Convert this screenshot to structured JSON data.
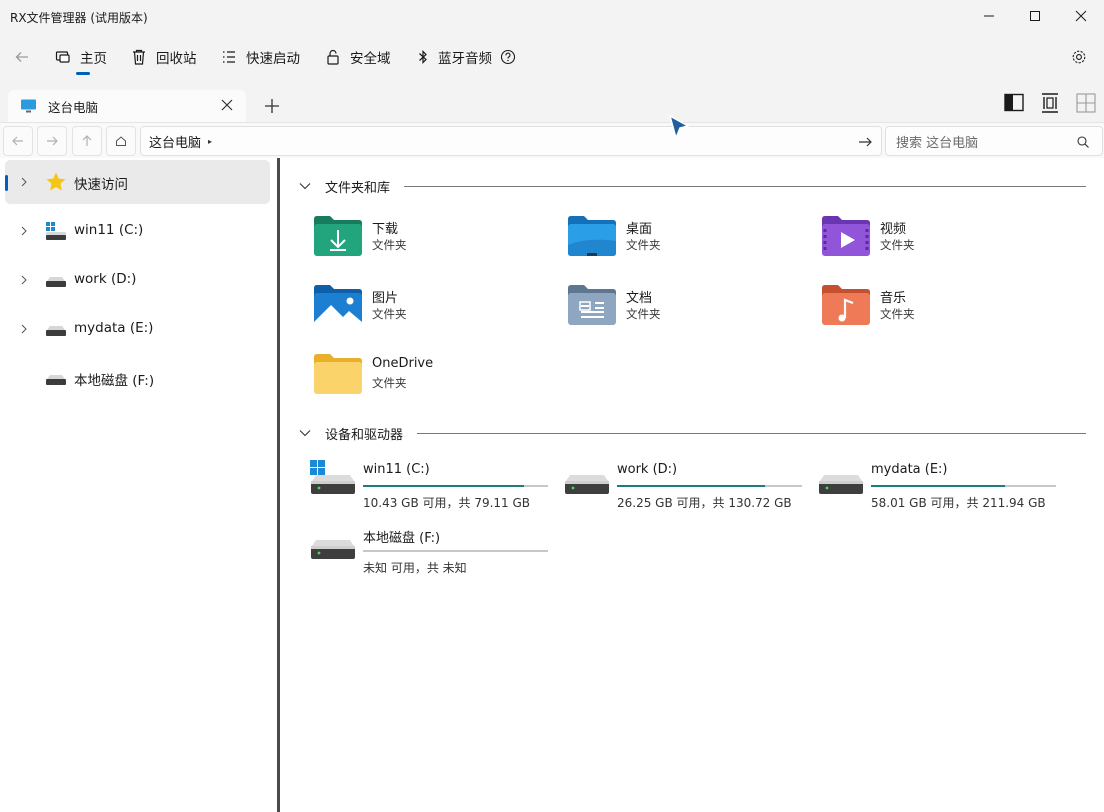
{
  "window": {
    "title": "RX文件管理器 (试用版本)"
  },
  "commands": {
    "home": "主页",
    "recycle": "回收站",
    "quick_launch": "快速启动",
    "secure_domain": "安全域",
    "bt_audio": "蓝牙音频"
  },
  "tab": {
    "label": "这台电脑"
  },
  "address": {
    "crumb": "这台电脑",
    "search_placeholder": "搜索 这台电脑"
  },
  "sidebar": {
    "items": [
      {
        "label": "快速访问",
        "icon": "star-icon",
        "active": true,
        "expandable": true
      },
      {
        "label": "win11 (C:)",
        "icon": "windows-drive-icon",
        "active": false,
        "expandable": true
      },
      {
        "label": "work (D:)",
        "icon": "drive-icon",
        "active": false,
        "expandable": true
      },
      {
        "label": "mydata (E:)",
        "icon": "drive-icon",
        "active": false,
        "expandable": true
      },
      {
        "label": "本地磁盘 (F:)",
        "icon": "drive-icon",
        "active": false,
        "expandable": false
      }
    ]
  },
  "groups": {
    "folders_title": "文件夹和库",
    "drives_title": "设备和驱动器"
  },
  "folders": [
    {
      "name": "下载",
      "type": "文件夹",
      "icon": "downloads-folder-icon",
      "color": "#1f9c74"
    },
    {
      "name": "桌面",
      "type": "文件夹",
      "icon": "desktop-folder-icon",
      "color": "#1d8fd6"
    },
    {
      "name": "视频",
      "type": "文件夹",
      "icon": "videos-folder-icon",
      "color": "#8a4fd0"
    },
    {
      "name": "图片",
      "type": "文件夹",
      "icon": "pictures-folder-icon",
      "color": "#1976c9"
    },
    {
      "name": "文档",
      "type": "文件夹",
      "icon": "documents-folder-icon",
      "color": "#7d93ad"
    },
    {
      "name": "音乐",
      "type": "文件夹",
      "icon": "music-folder-icon",
      "color": "#e06a4a"
    },
    {
      "name": "OneDrive",
      "type": "文件夹",
      "icon": "onedrive-folder-icon",
      "color": "#f2c94c"
    }
  ],
  "drives": [
    {
      "name": "win11 (C:)",
      "info": "10.43 GB 可用，共 79.11 GB",
      "used_fraction": 0.868,
      "icon": "windows-drive-icon"
    },
    {
      "name": "work (D:)",
      "info": "26.25 GB 可用，共 130.72 GB",
      "used_fraction": 0.799,
      "icon": "drive-icon"
    },
    {
      "name": "mydata (E:)",
      "info": "58.01 GB 可用，共 211.94 GB",
      "used_fraction": 0.726,
      "icon": "drive-icon"
    },
    {
      "name": "本地磁盘 (F:)",
      "info": "未知 可用，共 未知",
      "used_fraction": 0,
      "icon": "drive-icon"
    }
  ],
  "colors": {
    "accent": "#005fb8",
    "usage_bar": "#1e7c7c"
  }
}
